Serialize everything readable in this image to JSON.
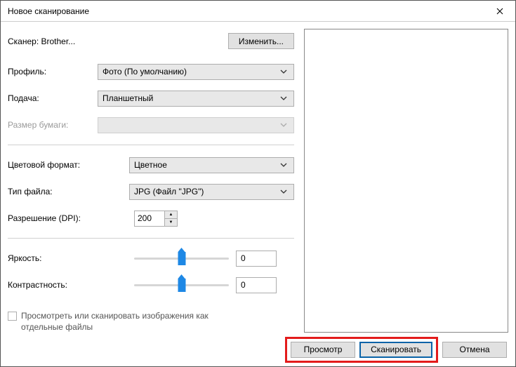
{
  "window": {
    "title": "Новое сканирование"
  },
  "scanner": {
    "label": "Сканер: Brother...",
    "change_button": "Изменить..."
  },
  "profile": {
    "label": "Профиль:",
    "value": "Фото (По умолчанию)"
  },
  "source": {
    "label": "Подача:",
    "value": "Планшетный"
  },
  "paper_size": {
    "label": "Размер бумаги:",
    "value": ""
  },
  "color_format": {
    "label": "Цветовой формат:",
    "value": "Цветное"
  },
  "file_type": {
    "label": "Тип файла:",
    "value": "JPG (Файл \"JPG\")"
  },
  "resolution": {
    "label": "Разрешение (DPI):",
    "value": "200"
  },
  "brightness": {
    "label": "Яркость:",
    "value": "0"
  },
  "contrast": {
    "label": "Контрастность:",
    "value": "0"
  },
  "separate_files": {
    "label": "Просмотреть или сканировать изображения как отдельные файлы",
    "checked": false
  },
  "footer": {
    "preview": "Просмотр",
    "scan": "Сканировать",
    "cancel": "Отмена"
  }
}
